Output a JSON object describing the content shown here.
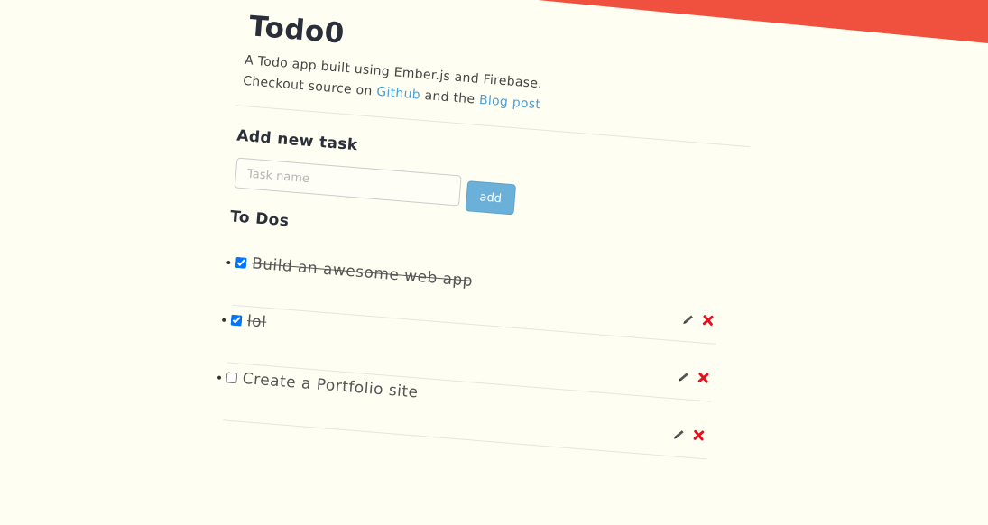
{
  "app": {
    "title": "Todo0",
    "subtitle": "A Todo app built using Ember.js and Firebase.",
    "source_prefix": "Checkout source on",
    "github_link": "Github",
    "source_middle": "and the",
    "blog_link": "Blog post"
  },
  "add_task": {
    "heading": "Add new task",
    "placeholder": "Task name",
    "button_label": "add"
  },
  "todos": {
    "heading": "To Dos",
    "items": [
      {
        "label": "Build an awesome web app",
        "done": true
      },
      {
        "label": "lol",
        "done": true
      },
      {
        "label": "Create a Portfolio site",
        "done": false
      }
    ]
  },
  "colors": {
    "background": "#fffef2",
    "ribbon": "#f0503e",
    "link": "#4a9fd5",
    "button": "#6ab0d8",
    "delete": "#e8101f"
  },
  "icons": {
    "edit": "pencil-icon",
    "delete": "x-icon"
  }
}
